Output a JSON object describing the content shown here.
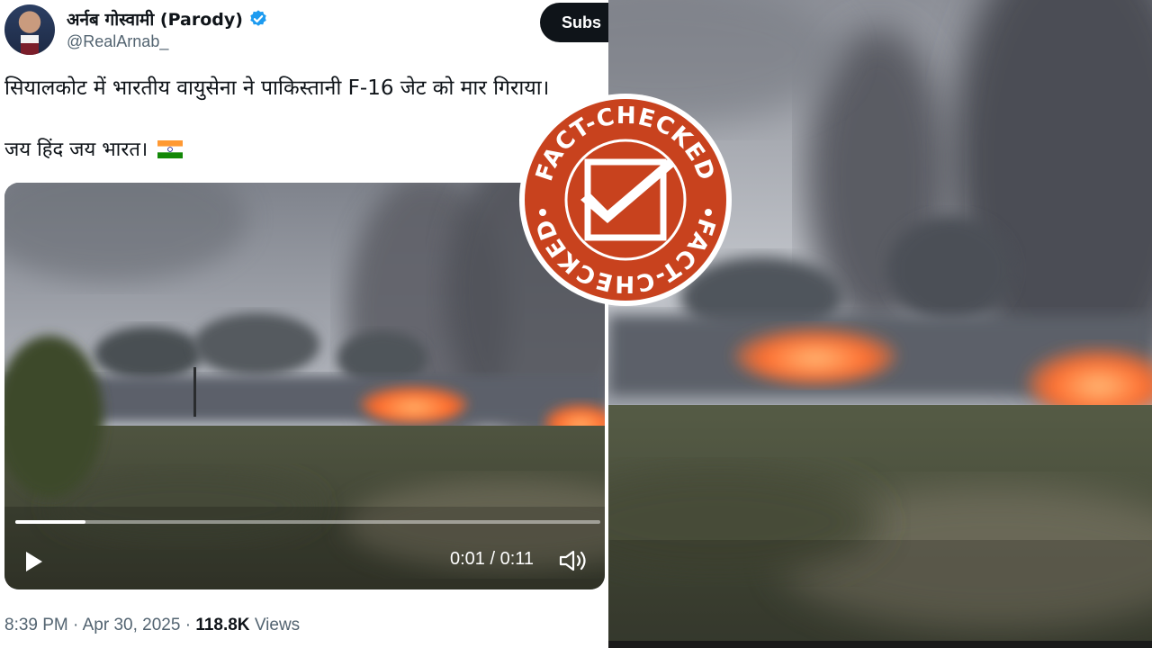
{
  "tweet": {
    "author_name": "अर्नब गोस्वामी (Parody)",
    "handle": "@RealArnab_",
    "subscribe_label": "Subs",
    "text_line1": "सियालकोट में भारतीय वायुसेना ने पाकिस्तानी F-16 जेट को मार गिराया।",
    "text_line2": "जय हिंद जय भारत।",
    "flag_icon": "india-flag-emoji",
    "time": "8:39 PM",
    "date": "Apr 30, 2025",
    "views_count": "118.8K",
    "views_label": "Views"
  },
  "video": {
    "timecode": "0:01 / 0:11",
    "progress": 0.12,
    "play_icon": "play-icon",
    "volume_icon": "volume-icon"
  },
  "stamp": {
    "text_top": "FACT-CHECKED",
    "text_bottom": "FACT-CHECKED",
    "color": "#c8421e"
  },
  "colors": {
    "verified": "#1d9bf0",
    "text_primary": "#0f1419",
    "text_secondary": "#536471",
    "fire": "#ff6a2a"
  }
}
